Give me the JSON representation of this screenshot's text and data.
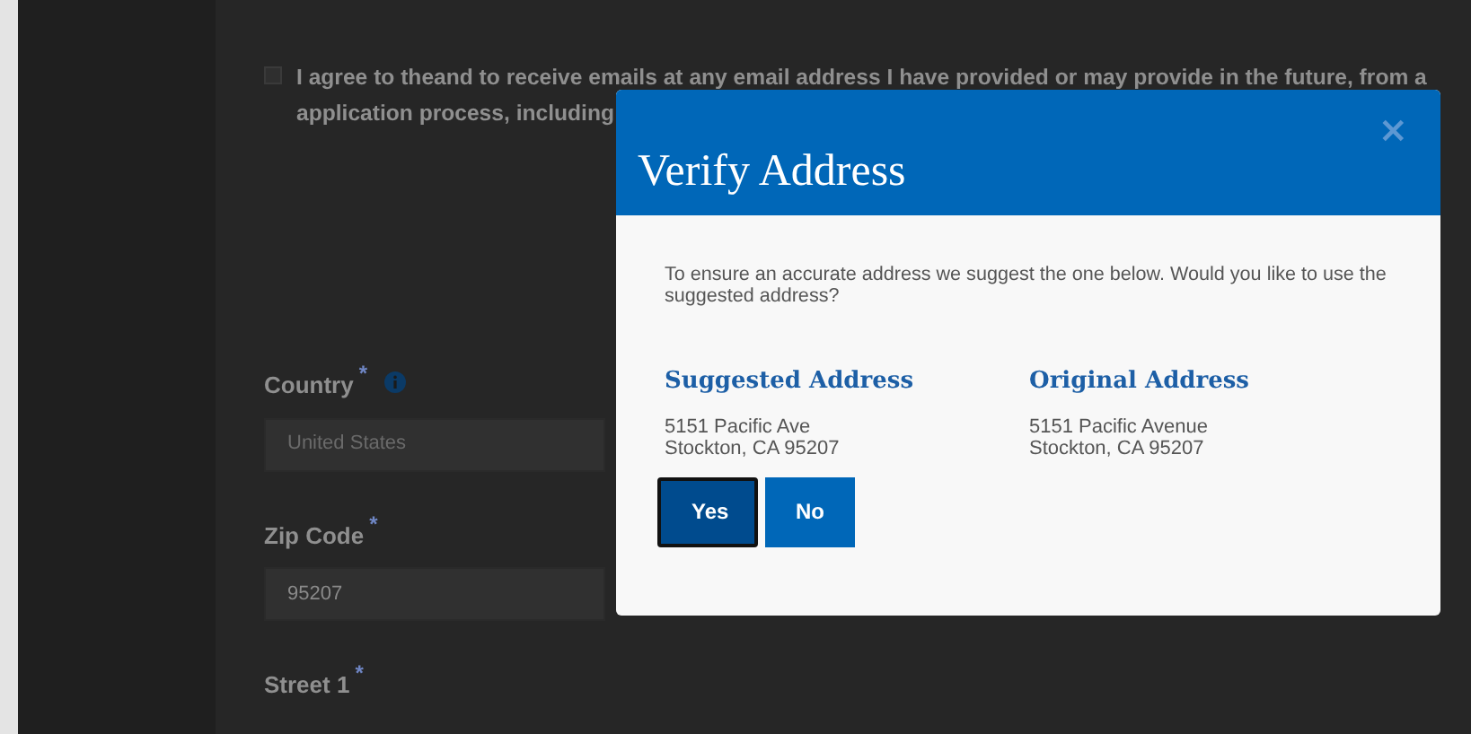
{
  "consent": {
    "checked": false,
    "lines": [
      "I agree to theand to receive emails at any email address I have provided or may provide in the future, from a",
      "application process, including"
    ]
  },
  "fields": [
    {
      "label": "Country",
      "required_mark": "*",
      "info": true,
      "value": "United States"
    },
    {
      "label": "Zip Code",
      "required_mark": "*",
      "value": "95207"
    },
    {
      "label": "Street 1",
      "required_mark": "*"
    }
  ],
  "dialog": {
    "title": "Verify Address",
    "close": "×",
    "message": "To ensure an accurate address we suggest the one below. Would you like to use the suggested address?",
    "addresses": [
      {
        "heading": "Suggested Address",
        "lines": [
          "5151 Pacific Ave",
          "Stockton, CA 95207"
        ]
      },
      {
        "heading": "Original Address",
        "lines": [
          "5151 Pacific Avenue",
          "Stockton, CA 95207"
        ]
      }
    ],
    "buttons": [
      {
        "label": "Yes",
        "focused": true
      },
      {
        "label": "No",
        "focused": false
      }
    ]
  }
}
